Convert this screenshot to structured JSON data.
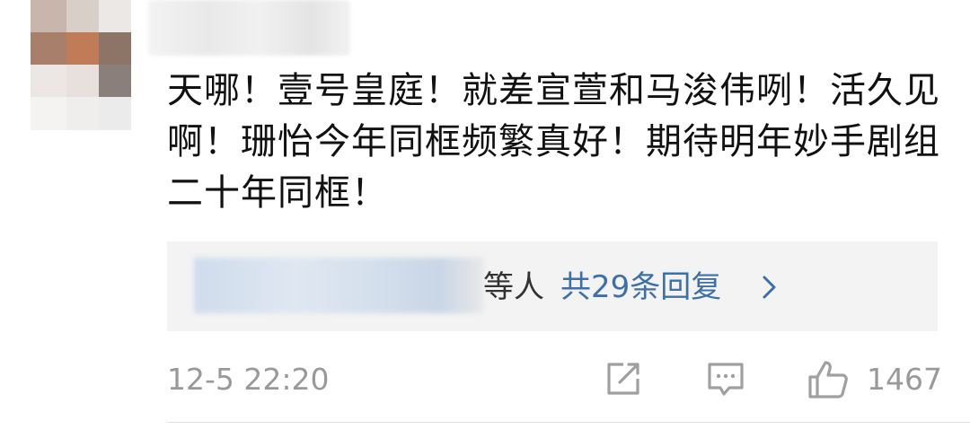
{
  "comment": {
    "text": "天哪！壹号皇庭！就差宣萱和马浚伟咧！活久见啊！珊怡今年同框频繁真好！期待明年妙手剧组二十年同框！",
    "timestamp": "12-5 22:20",
    "like_count": "1467"
  },
  "replies": {
    "suffix_label": "等人",
    "count_label": "共29条回复"
  },
  "icons": {
    "share": "share-icon",
    "comment": "comment-icon",
    "like": "thumbs-up-icon",
    "chevron": "chevron-right-icon"
  },
  "colors": {
    "link": "#3d6fa8",
    "meta": "#999999",
    "reply_bg": "#f3f3f3"
  }
}
